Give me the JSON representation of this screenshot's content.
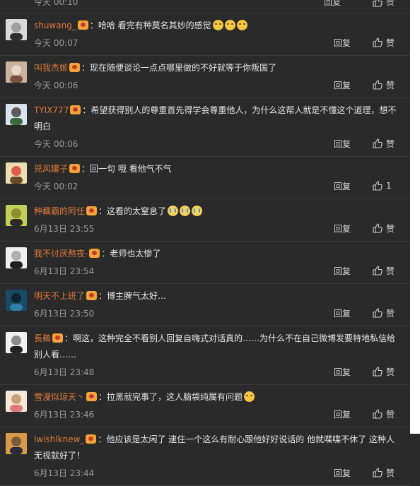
{
  "labels": {
    "reply": "回复",
    "like": "赞"
  },
  "partial": {
    "time": "今天 00:10"
  },
  "comments": [
    {
      "user": "shuwang_",
      "text": "：哈哈 看完有种莫名其妙的感觉",
      "emojis": [
        "grin",
        "grin",
        "grin"
      ],
      "time": "今天 00:07",
      "like": "赞",
      "avatar_colors": [
        "#d9d9d9",
        "#2e2e2e",
        "#a0a0a0"
      ]
    },
    {
      "user": "叫我杰姬",
      "text": "：现在随便谈论一点点哪里做的不好就等于你叛国了",
      "emojis": [],
      "time": "今天 00:06",
      "like": "赞",
      "avatar_colors": [
        "#c9b39e",
        "#7a5040",
        "#e8d6c6"
      ]
    },
    {
      "user": "TYIX777",
      "text": "：希望获得别人的尊重首先得学会尊重他人，为什么这帮人就是不懂这个道理，想不明白",
      "emojis": [],
      "time": "今天 00:06",
      "like": "赞",
      "avatar_colors": [
        "#d8e3ee",
        "#3c6a3c",
        "#5c5c5c"
      ]
    },
    {
      "user": "兕风罐子",
      "text": "：回一句 哦 看他气不气",
      "emojis": [],
      "time": "今天 00:02",
      "like": "1",
      "avatar_colors": [
        "#e9dfb0",
        "#6b4a2a",
        "#e35b4a"
      ]
    },
    {
      "user": "种藕霸的阿任",
      "text": "：这看的太窒息了",
      "emojis": [
        "cry",
        "cry",
        "cry"
      ],
      "time": "6月13日 23:55",
      "like": "赞",
      "avatar_colors": [
        "#c3cc55",
        "#2b2b2b",
        "#8a8f30"
      ]
    },
    {
      "user": "我不讨厌熬夜-",
      "text": "：老师也太惨了",
      "emojis": [],
      "time": "6月13日 23:54",
      "like": "赞",
      "avatar_colors": [
        "#efefef",
        "#1e1e1e",
        "#b0b0b0"
      ]
    },
    {
      "user": "明天不上班了",
      "text": "：博主脾气太好…",
      "emojis": [],
      "time": "6月13日 23:50",
      "like": "赞",
      "avatar_colors": [
        "#184a66",
        "#2f7fa8",
        "#0c2433"
      ]
    },
    {
      "user": "長鵜",
      "text": "：啊这，这种完全不看别人回复自嗨式对话真的……为什么不在自己微博发要特地私信给别人看……",
      "emojis": [],
      "time": "6月13日 23:48",
      "like": "赞",
      "avatar_colors": [
        "#f2f2f2",
        "#222222",
        "#8c8c8c"
      ]
    },
    {
      "user": "雪漫似琼天丶",
      "text": "：拉黑就完事了，这人脑袋纯属有问题",
      "emojis": [
        "grin"
      ],
      "time": "6月13日 23:46",
      "like": "赞",
      "avatar_colors": [
        "#f6e7d6",
        "#e07a7a",
        "#c9a07a"
      ]
    },
    {
      "user": "lwishlknew_",
      "text": "：他应该是太闲了 逮住一个这么有耐心跟他好好说话的 他就喋喋不休了 这种人无视就好了！",
      "emojis": [],
      "time": "6月13日 23:44",
      "like": "赞",
      "avatar_colors": [
        "#d89a4a",
        "#2a2a3a",
        "#7a5a3a"
      ]
    }
  ]
}
